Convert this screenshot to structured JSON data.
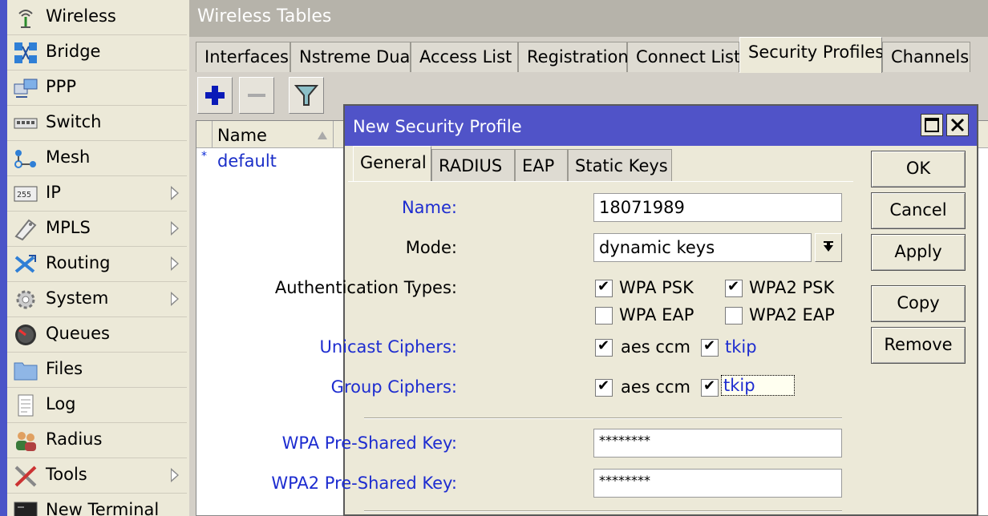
{
  "sidebar": {
    "items": [
      {
        "label": "Wireless",
        "icon": "wireless-antenna-icon",
        "has_submenu": false
      },
      {
        "label": "Bridge",
        "icon": "bridge-icon",
        "has_submenu": false
      },
      {
        "label": "PPP",
        "icon": "ppp-icon",
        "has_submenu": false
      },
      {
        "label": "Switch",
        "icon": "switch-icon",
        "has_submenu": false
      },
      {
        "label": "Mesh",
        "icon": "mesh-icon",
        "has_submenu": false
      },
      {
        "label": "IP",
        "icon": "ip-icon",
        "has_submenu": true
      },
      {
        "label": "MPLS",
        "icon": "mpls-icon",
        "has_submenu": true
      },
      {
        "label": "Routing",
        "icon": "routing-icon",
        "has_submenu": true
      },
      {
        "label": "System",
        "icon": "gear-icon",
        "has_submenu": true
      },
      {
        "label": "Queues",
        "icon": "queues-gauge-icon",
        "has_submenu": false
      },
      {
        "label": "Files",
        "icon": "folder-icon",
        "has_submenu": false
      },
      {
        "label": "Log",
        "icon": "log-document-icon",
        "has_submenu": false
      },
      {
        "label": "Radius",
        "icon": "users-icon",
        "has_submenu": false
      },
      {
        "label": "Tools",
        "icon": "tools-icon",
        "has_submenu": true
      },
      {
        "label": "New Terminal",
        "icon": "terminal-icon",
        "has_submenu": false
      }
    ]
  },
  "window": {
    "title": "Wireless Tables",
    "tabs": [
      "Interfaces",
      "Nstreme Dual",
      "Access List",
      "Registration",
      "Connect List",
      "Security Profiles",
      "Channels"
    ],
    "active_tab": "Security Profiles"
  },
  "toolbar": {
    "add": "add-icon",
    "remove": "remove-icon",
    "filter": "filter-icon"
  },
  "list": {
    "columns": [
      "Name"
    ],
    "rows": [
      {
        "marker": "*",
        "name": "default"
      }
    ]
  },
  "dialog": {
    "title": "New Security Profile",
    "tabs": [
      "General",
      "RADIUS",
      "EAP",
      "Static Keys"
    ],
    "active_tab": "General",
    "fields": {
      "name_label": "Name:",
      "name_value": "18071989",
      "mode_label": "Mode:",
      "mode_value": "dynamic keys",
      "auth_label": "Authentication Types:",
      "auth": [
        {
          "label": "WPA PSK",
          "checked": true
        },
        {
          "label": "WPA2 PSK",
          "checked": true
        },
        {
          "label": "WPA EAP",
          "checked": false
        },
        {
          "label": "WPA2 EAP",
          "checked": false
        }
      ],
      "unicast_label": "Unicast Ciphers:",
      "unicast": [
        {
          "label": "aes ccm",
          "checked": true
        },
        {
          "label": "tkip",
          "checked": true
        }
      ],
      "group_label": "Group Ciphers:",
      "group": [
        {
          "label": "aes ccm",
          "checked": true
        },
        {
          "label": "tkip",
          "checked": true
        }
      ],
      "wpa_psk_label": "WPA Pre-Shared Key:",
      "wpa_psk_value": "********",
      "wpa2_psk_label": "WPA2 Pre-Shared Key:",
      "wpa2_psk_value": "********"
    },
    "buttons": [
      "OK",
      "Cancel",
      "Apply",
      "Copy",
      "Remove"
    ]
  },
  "colors": {
    "sidebar_stripe": "#4a54c8",
    "dialog_title": "#5053c8",
    "link_blue": "#1d2cd0"
  }
}
